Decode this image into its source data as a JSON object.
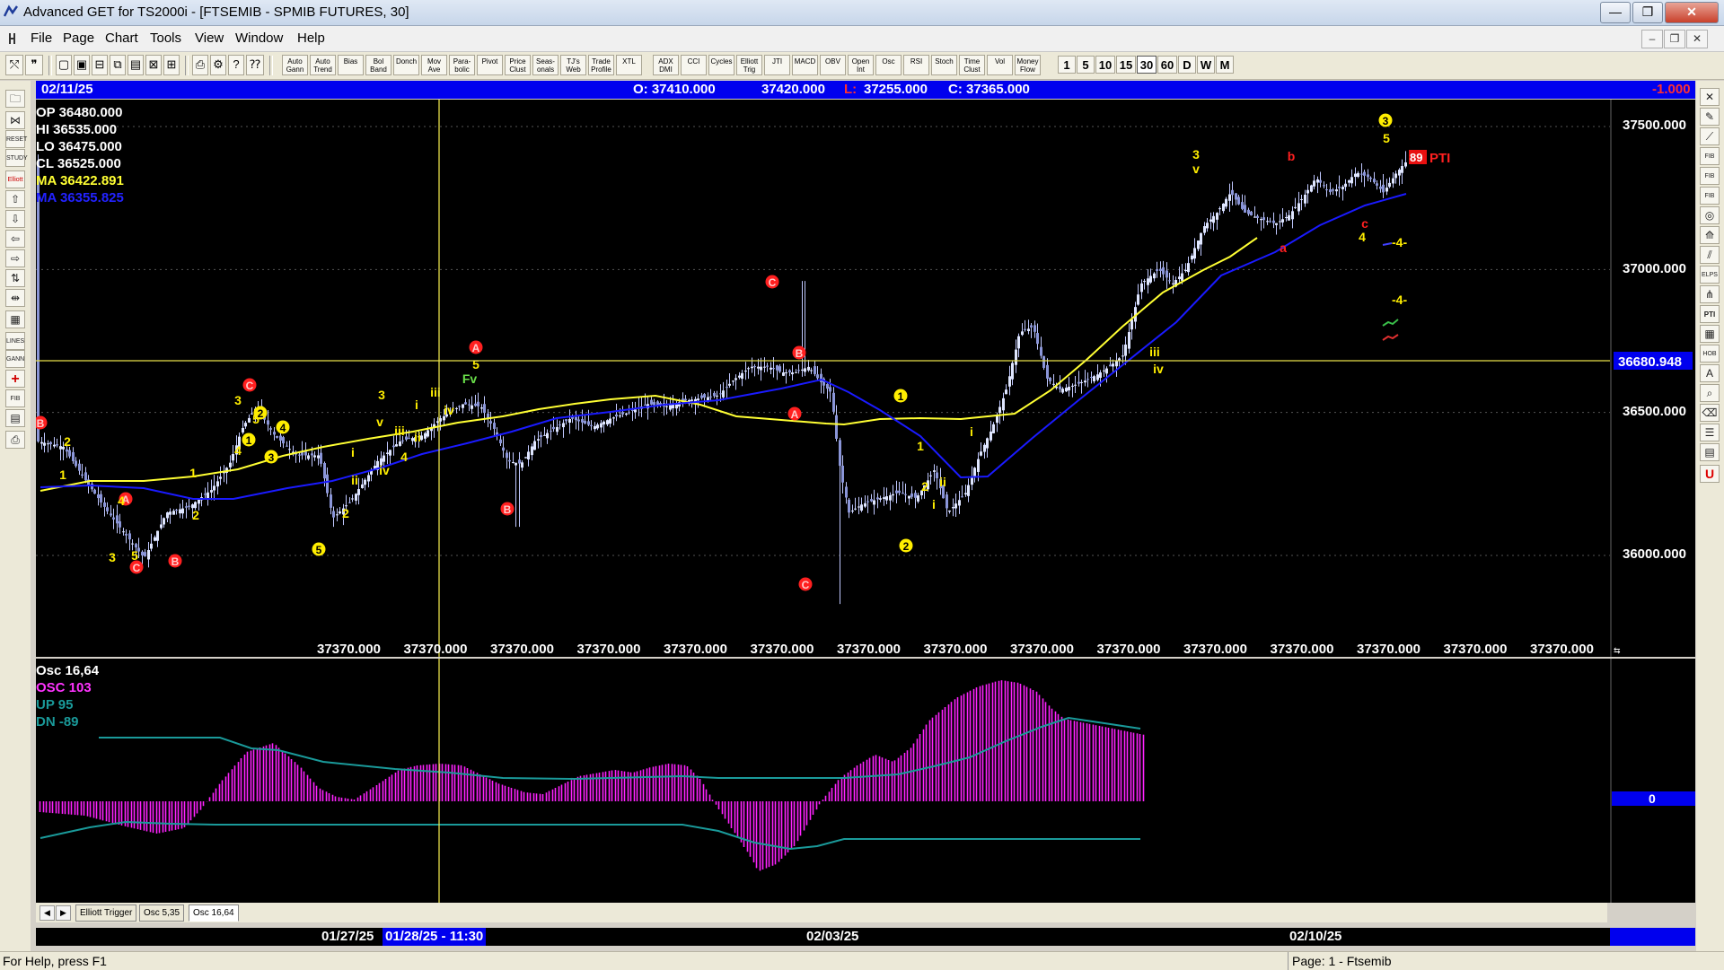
{
  "window": {
    "title": "Advanced GET for TS2000i - [FTSEMIB - SPMIB FUTURES, 30]",
    "buttons": [
      "—",
      "❐",
      "✕"
    ]
  },
  "menu": {
    "items": [
      "File",
      "Page",
      "Chart",
      "Tools",
      "View",
      "Window",
      "Help"
    ],
    "mdi_buttons": [
      "–",
      "❐",
      "✕"
    ]
  },
  "toolbar": {
    "study_buttons": [
      "Auto Gann",
      "Auto Trend",
      "Bias",
      "Bol Band",
      "Donch",
      "Mov Ave",
      "Para-bolic",
      "Pivot",
      "Price Clust",
      "Seas-onals",
      "TJ's Web",
      "Trade Profile",
      "XTL",
      "ADX DMI",
      "CCI",
      "Cycles",
      "Elliott Trig",
      "JTI",
      "MACD",
      "OBV",
      "Open Int",
      "Osc",
      "RSI",
      "Stoch",
      "Time Clust",
      "Vol",
      "Money Flow"
    ],
    "intervals": [
      "1",
      "5",
      "10",
      "15",
      "30",
      "60",
      "D",
      "W",
      "M"
    ],
    "selected_interval": "30"
  },
  "infobar": {
    "date": "02/11/25",
    "open": "O: 37410.000",
    "high": "37420.000",
    "low_label": "L:",
    "low": "37255.000",
    "close": "C: 37365.000",
    "change": "-1.000"
  },
  "readout": {
    "op": "OP 36480.000",
    "hi": "HI 36535.000",
    "lo": "LO 36475.000",
    "cl": "CL 36525.000",
    "ma_yellow": "MA 36422.891",
    "ma_blue": "MA 36355.825"
  },
  "price_axis": {
    "ticks": [
      "37500.000",
      "37000.000",
      "36500.000",
      "36000.000"
    ],
    "current": "36680.948",
    "bottom_labels": [
      "37370.000",
      "37370.000",
      "37370.000",
      "37370.000",
      "37370.000",
      "37370.000",
      "37370.000",
      "37370.000",
      "37370.000",
      "37370.000",
      "37370.000",
      "37370.000",
      "37370.000",
      "37370.000",
      "37370.000"
    ],
    "pti": "89",
    "pti_label": "PTI",
    "projection_labels": [
      "-4-",
      "-4-"
    ]
  },
  "oscillator": {
    "title": "Osc 16,64",
    "osc": "OSC 103",
    "up": "UP 95",
    "dn": "DN -89",
    "zero_label": "0"
  },
  "tabs": [
    "Elliott Trigger",
    "Osc 5,35",
    "Osc 16,64"
  ],
  "active_tab": "Osc 16,64",
  "dates": {
    "d1": "01/27/25",
    "d2": "01/28/25 - 11:30",
    "d3": "02/03/25",
    "d4": "02/10/25"
  },
  "status": {
    "left": "For Help, press F1",
    "right": "Page: 1 - Ftsemib"
  },
  "colors": {
    "background": "#000000",
    "ma_yellow": "#ffff33",
    "ma_blue": "#1a1aff",
    "osc_bars": "#ff22ff",
    "bands": "#1a9a9a",
    "wave_red": "#ff2020",
    "wave_yellow": "#ffee00"
  }
}
